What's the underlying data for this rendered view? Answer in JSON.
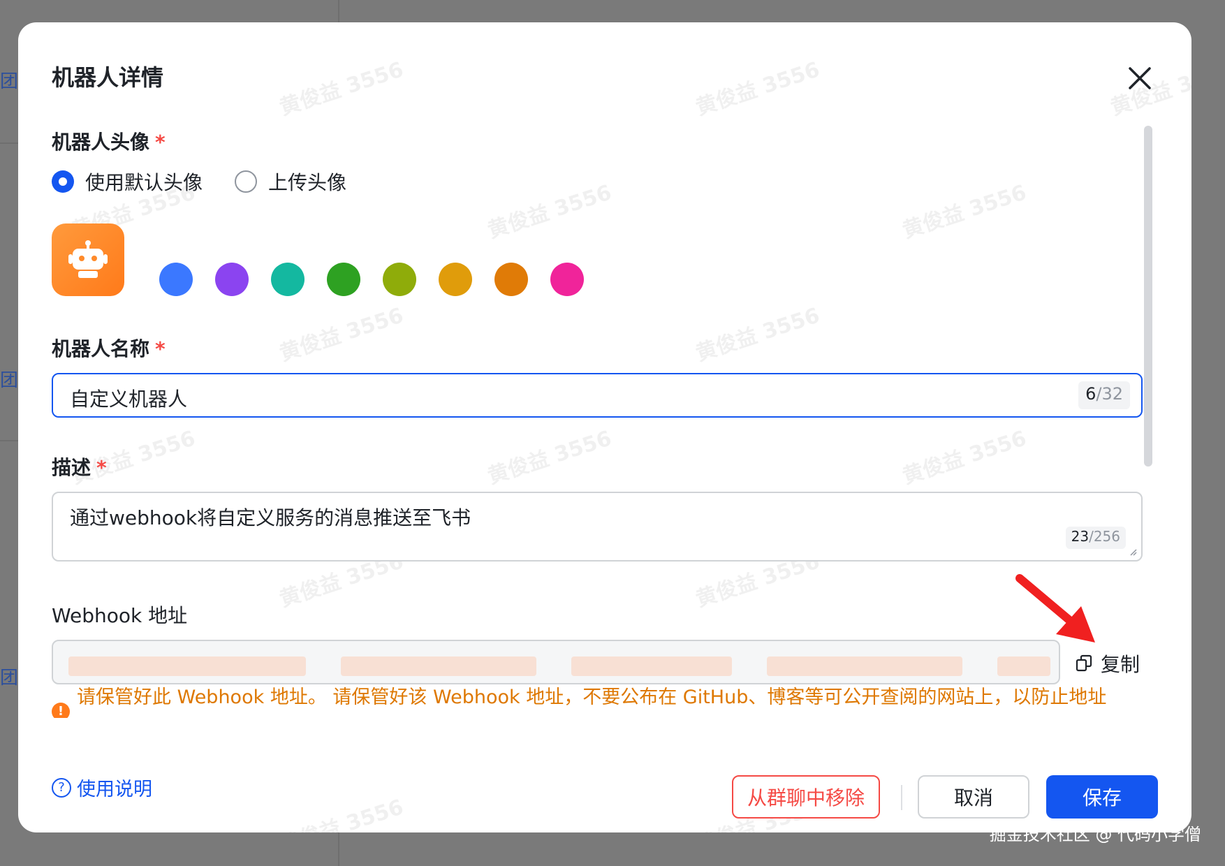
{
  "modal": {
    "title": "机器人详情",
    "watermark": "黄俊益 3556"
  },
  "avatar_section": {
    "label": "机器人头像",
    "required_mark": "*",
    "options": [
      {
        "label": "使用默认头像",
        "selected": true
      },
      {
        "label": "上传头像",
        "selected": false
      }
    ],
    "avatar_icon": "robot-icon",
    "swatches": [
      "#3b78ff",
      "#8b44f0",
      "#14b8a0",
      "#2ea122",
      "#8fac0a",
      "#e09c0b",
      "#e07b07",
      "#f0249a"
    ]
  },
  "name_section": {
    "label": "机器人名称",
    "required_mark": "*",
    "value": "自定义机器人",
    "count": "6",
    "max": "/32"
  },
  "description_section": {
    "label": "描述",
    "required_mark": "*",
    "value": "通过webhook将自定义服务的消息推送至飞书",
    "count": "23",
    "max": "/256"
  },
  "webhook_section": {
    "label": "Webhook 地址",
    "copy_label": "复制",
    "warning": "请保管好此 Webhook 地址。 请保管好该 Webhook 地址，不要公布在 GitHub、博客等可公开查阅的网站上，以防止地址"
  },
  "footer": {
    "help_label": "使用说明",
    "remove_label": "从群聊中移除",
    "cancel_label": "取消",
    "save_label": "保存"
  },
  "background": {
    "side_link": "团册"
  },
  "credit": "掘金技术社区 @ 代码小学僧",
  "colors": {
    "primary": "#1456f0",
    "danger": "#f54a45",
    "warning": "#de7802",
    "avatar": "#ff8a2a"
  }
}
